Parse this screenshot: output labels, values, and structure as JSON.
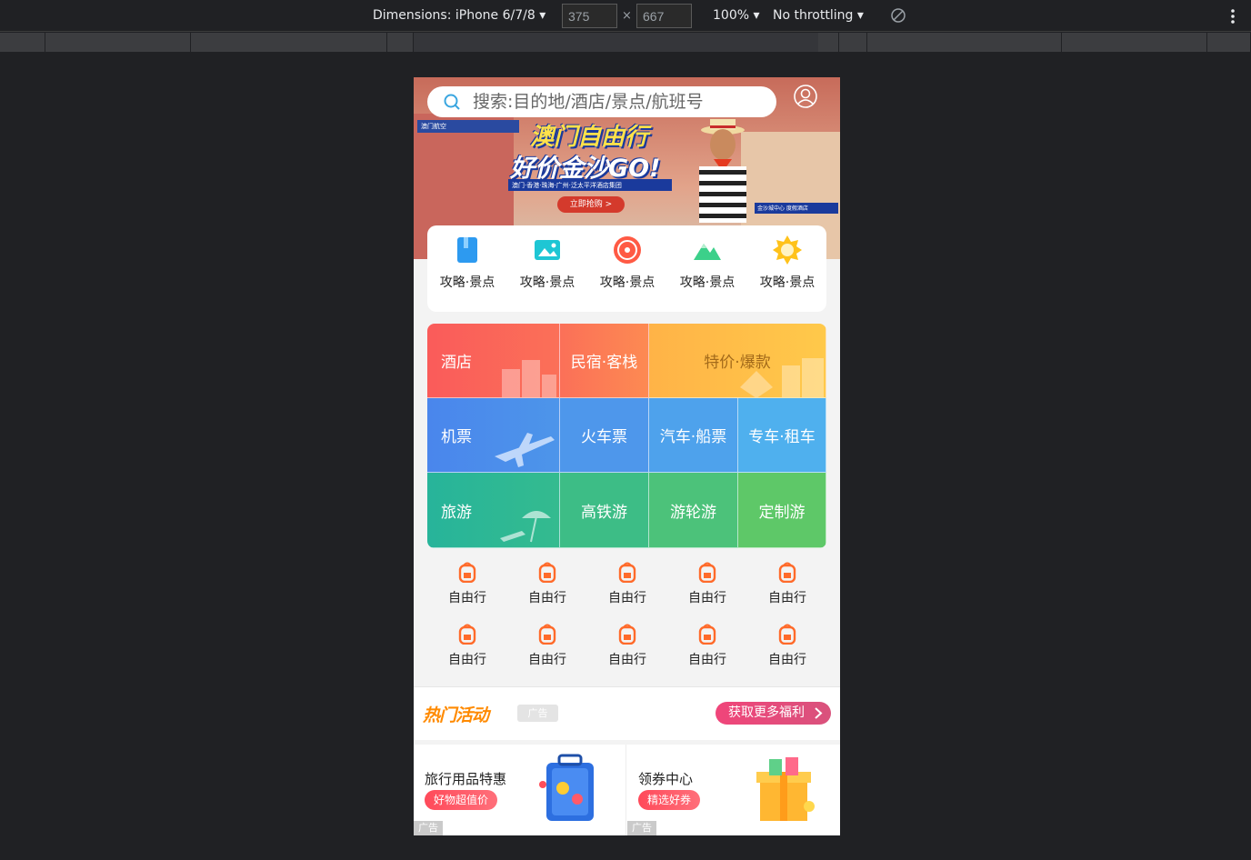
{
  "devtools": {
    "dimensions_label": "Dimensions: iPhone 6/7/8",
    "width_value": "375",
    "height_value": "667",
    "times_sign": "×",
    "zoom_label": "100%",
    "throttling_label": "No throttling"
  },
  "search": {
    "placeholder": "搜索:目的地/酒店/景点/航班号"
  },
  "user": {
    "label": "我的"
  },
  "banner": {
    "logo_text": "澳门航空",
    "title_line1": "澳门自由行",
    "title_line2": "好价金沙GO!",
    "subtitle": "澳门·香港·珠海·广州·泛太平洋酒店集团",
    "cta": "立即抢购 >",
    "corner_tag": "金沙城中心 度假酒店"
  },
  "quick_entries": [
    {
      "label": "攻略·景点",
      "icon": "book-icon"
    },
    {
      "label": "攻略·景点",
      "icon": "picture-icon"
    },
    {
      "label": "攻略·景点",
      "icon": "red-badge-icon"
    },
    {
      "label": "攻略·景点",
      "icon": "mountain-icon"
    },
    {
      "label": "攻略·景点",
      "icon": "sun-badge-icon"
    }
  ],
  "grid": {
    "row1": [
      "酒店",
      "民宿·客栈",
      "特价·爆款"
    ],
    "row2": [
      "机票",
      "火车票",
      "汽车·船票",
      "专车·租车"
    ],
    "row3": [
      "旅游",
      "高铁游",
      "游轮游",
      "定制游"
    ]
  },
  "mini_entries": {
    "row1": [
      "自由行",
      "自由行",
      "自由行",
      "自由行",
      "自由行"
    ],
    "row2": [
      "自由行",
      "自由行",
      "自由行",
      "自由行",
      "自由行"
    ]
  },
  "promo": {
    "title": "热门活动",
    "ad_badge": "广告",
    "more_button": "获取更多福利"
  },
  "cards": [
    {
      "title": "旅行用品特惠",
      "tag": "好物超值价",
      "ad": "广告"
    },
    {
      "title": "领券中心",
      "tag": "精选好券",
      "ad": "广告"
    }
  ],
  "colors": {
    "hotel_gradient": "#f76b5b",
    "flight_gradient": "#4a8fe8",
    "travel_gradient": "#2bb8a0",
    "promo_orange": "#ff8a00",
    "tag_pink": "#f0457a"
  }
}
